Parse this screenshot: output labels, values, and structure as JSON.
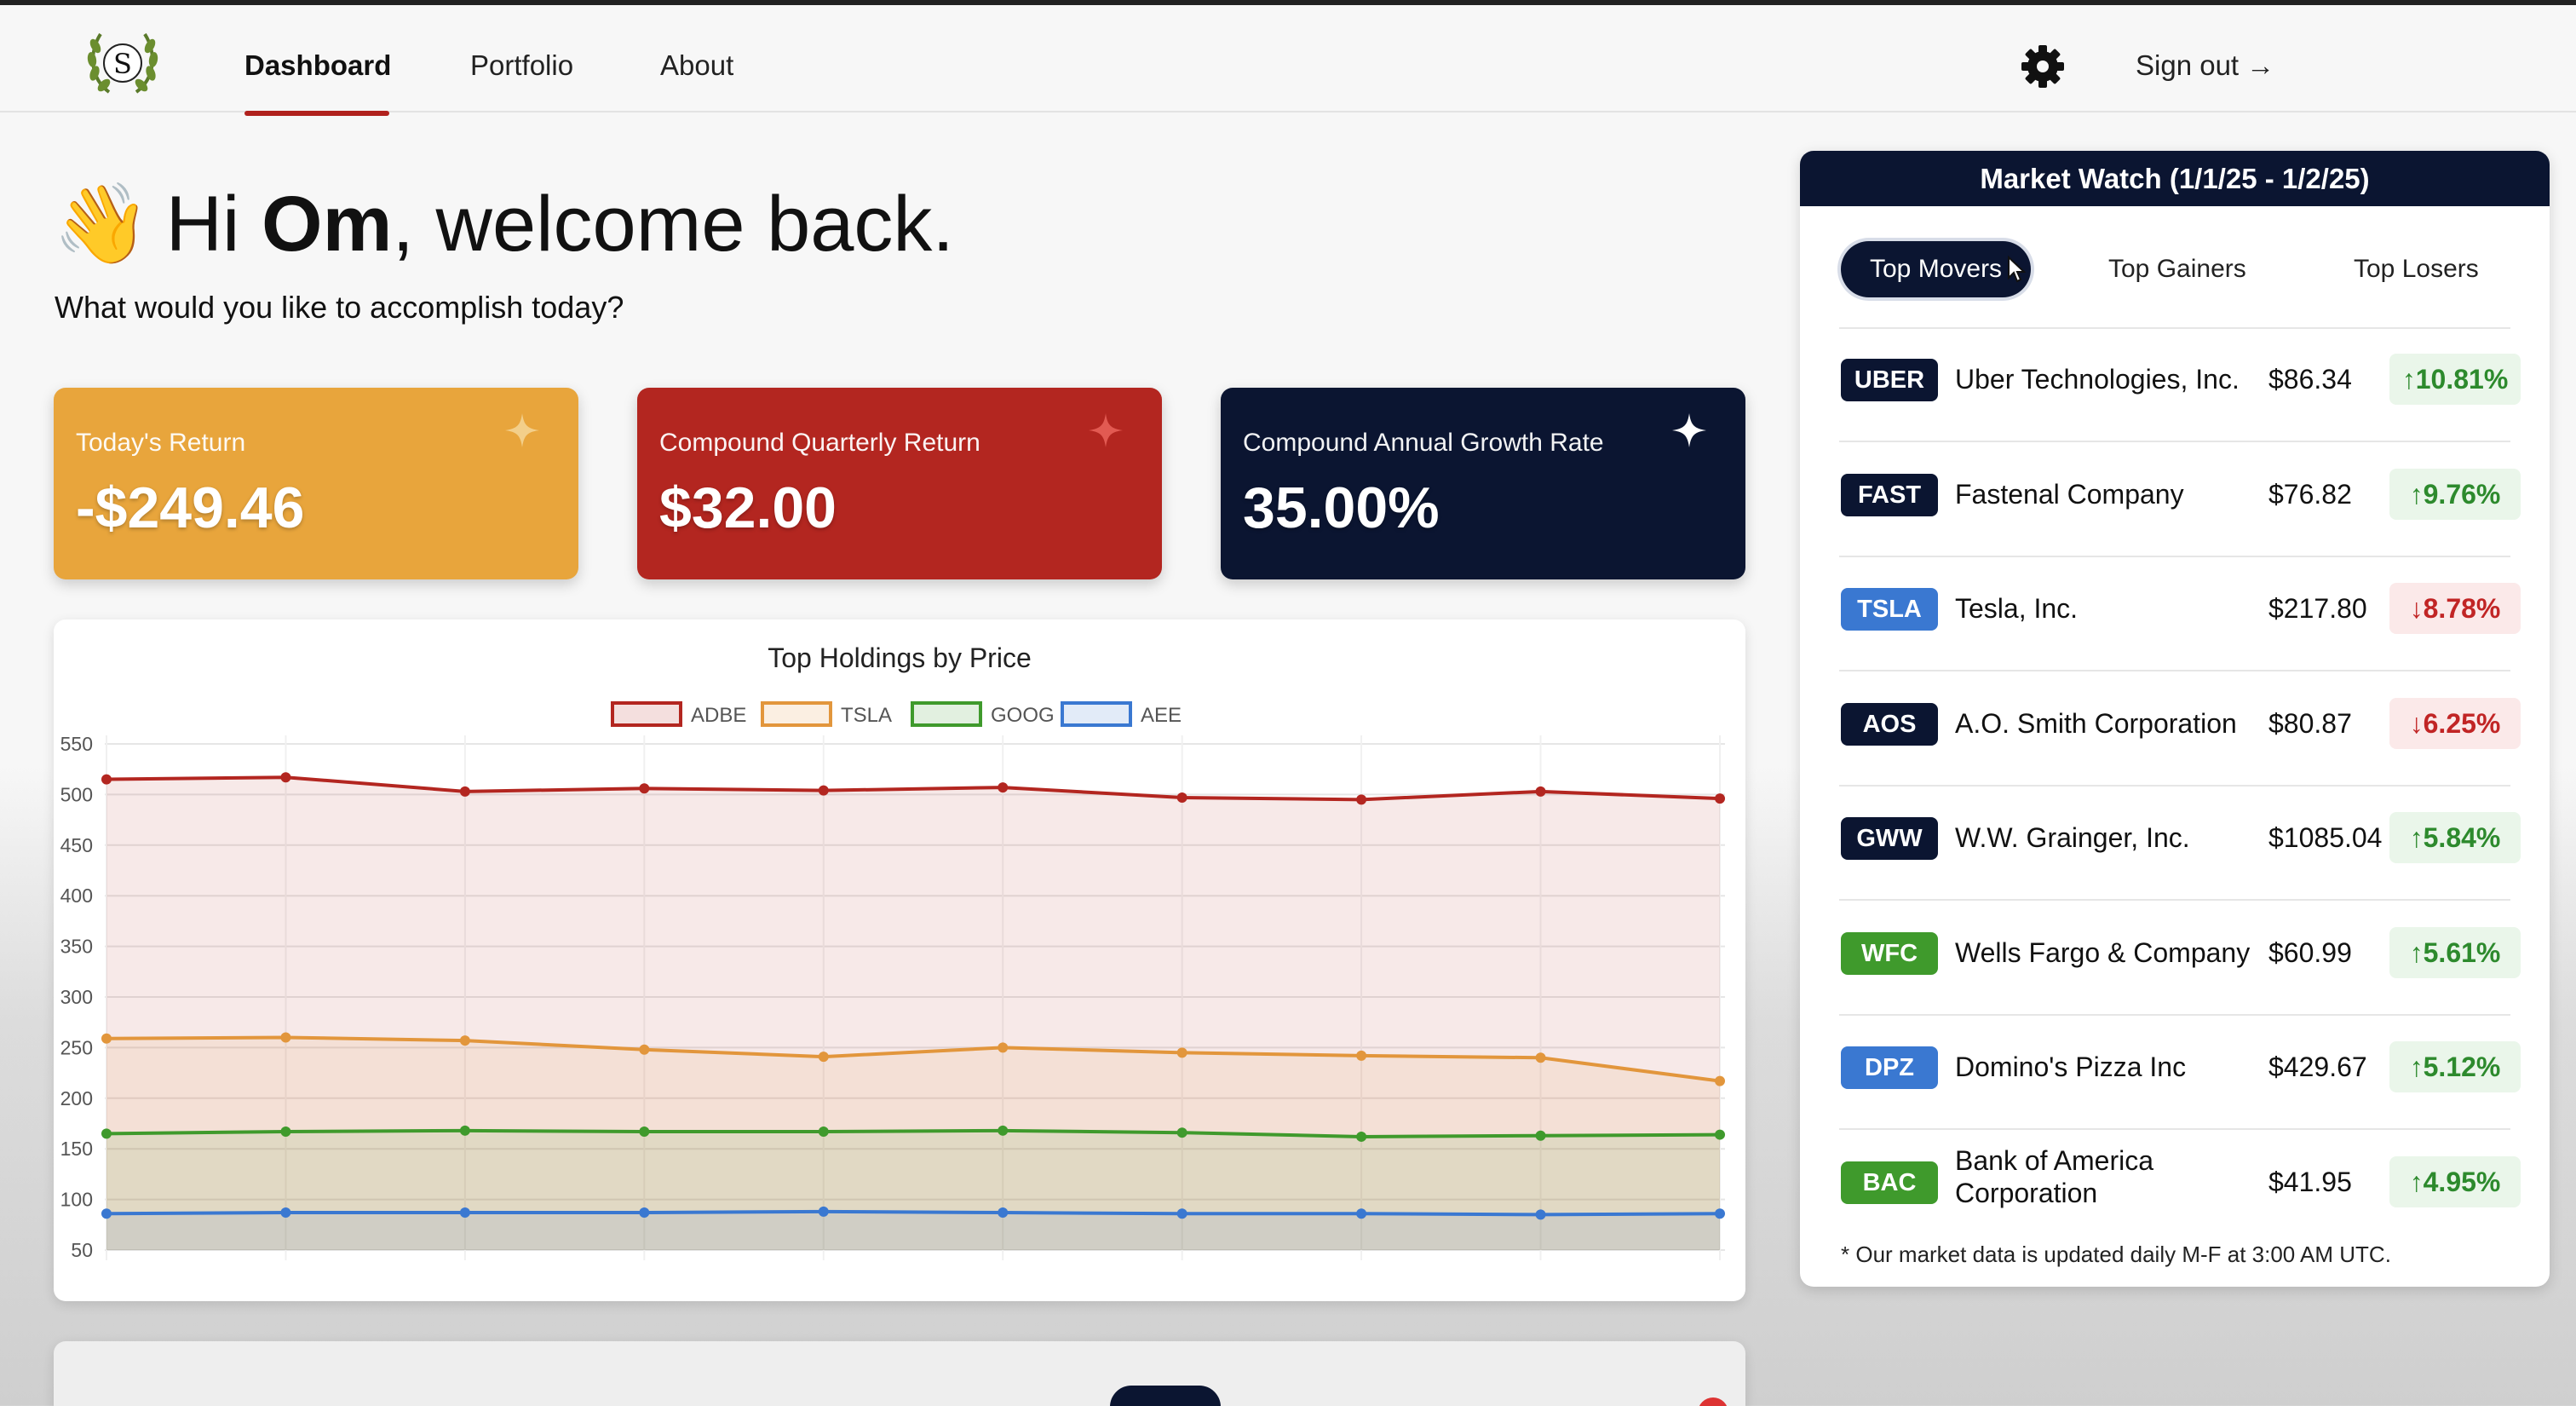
{
  "nav": {
    "items": [
      {
        "label": "Dashboard",
        "active": true
      },
      {
        "label": "Portfolio",
        "active": false
      },
      {
        "label": "About",
        "active": false
      }
    ],
    "sign_out": "Sign out →",
    "logo_text": "S"
  },
  "greeting": {
    "wave": "👋",
    "prefix": "Hi ",
    "name": "Om",
    "suffix": ", welcome back.",
    "subtitle": "What would you like to accomplish today?"
  },
  "cards": [
    {
      "label": "Today's Return",
      "value": "-$249.46",
      "color": "#e8a53c"
    },
    {
      "label": "Compound Quarterly Return",
      "value": "$32.00",
      "color": "#b32620"
    },
    {
      "label": "Compound Annual Growth Rate",
      "value": "35.00%",
      "color": "#0b1531"
    }
  ],
  "chart_data": {
    "type": "line",
    "title": "Top Holdings by Price",
    "x": [
      1,
      2,
      3,
      4,
      5,
      6,
      7,
      8,
      9,
      10
    ],
    "yticks": [
      550,
      500,
      450,
      400,
      350,
      300,
      250,
      200,
      150,
      100,
      50
    ],
    "ylim": [
      50,
      550
    ],
    "grid": true,
    "legend_position": "top",
    "series": [
      {
        "name": "ADBE",
        "color": "#b32620",
        "values": [
          515,
          517,
          503,
          506,
          504,
          507,
          497,
          495,
          503,
          496
        ]
      },
      {
        "name": "TSLA",
        "color": "#e2963c",
        "values": [
          259,
          260,
          257,
          248,
          241,
          250,
          245,
          242,
          240,
          217
        ]
      },
      {
        "name": "GOOG",
        "color": "#3f9a2c",
        "values": [
          165,
          167,
          168,
          167,
          167,
          168,
          166,
          162,
          163,
          164
        ]
      },
      {
        "name": "AEE",
        "color": "#3a78d1",
        "values": [
          86,
          87,
          87,
          87,
          88,
          87,
          86,
          86,
          85,
          86
        ]
      }
    ]
  },
  "market": {
    "title": "Market Watch (1/1/25 - 1/2/25)",
    "tabs": [
      {
        "label": "Top Movers",
        "active": true
      },
      {
        "label": "Top Gainers",
        "active": false
      },
      {
        "label": "Top Losers",
        "active": false
      }
    ],
    "rows": [
      {
        "symbol": "UBER",
        "name": "Uber Technologies, Inc.",
        "price": "$86.34",
        "change": "↑10.81%",
        "dir": "up",
        "badge": "#0b1531"
      },
      {
        "symbol": "FAST",
        "name": "Fastenal Company",
        "price": "$76.82",
        "change": "↑9.76%",
        "dir": "up",
        "badge": "#0b1531"
      },
      {
        "symbol": "TSLA",
        "name": "Tesla, Inc.",
        "price": "$217.80",
        "change": "↓8.78%",
        "dir": "down",
        "badge": "#3a78d1"
      },
      {
        "symbol": "AOS",
        "name": "A.O. Smith Corporation",
        "price": "$80.87",
        "change": "↓6.25%",
        "dir": "down",
        "badge": "#0b1531"
      },
      {
        "symbol": "GWW",
        "name": "W.W. Grainger, Inc.",
        "price": "$1085.04",
        "change": "↑5.84%",
        "dir": "up",
        "badge": "#0b1531"
      },
      {
        "symbol": "WFC",
        "name": "Wells Fargo & Company",
        "price": "$60.99",
        "change": "↑5.61%",
        "dir": "up",
        "badge": "#3f9a2c"
      },
      {
        "symbol": "DPZ",
        "name": "Domino's Pizza Inc",
        "price": "$429.67",
        "change": "↑5.12%",
        "dir": "up",
        "badge": "#3a78d1"
      },
      {
        "symbol": "BAC",
        "name": "Bank of America Corporation",
        "price": "$41.95",
        "change": "↑4.95%",
        "dir": "up",
        "badge": "#3f9a2c"
      }
    ],
    "footnote": "* Our market data is updated daily M-F at 3:00 AM UTC."
  },
  "icons": {
    "settings": "gear-icon",
    "sparkle": "sparkle-icon",
    "logo": "laurel-logo-icon"
  },
  "colors": {
    "accent": "#b0211d",
    "navy": "#0b1531"
  }
}
